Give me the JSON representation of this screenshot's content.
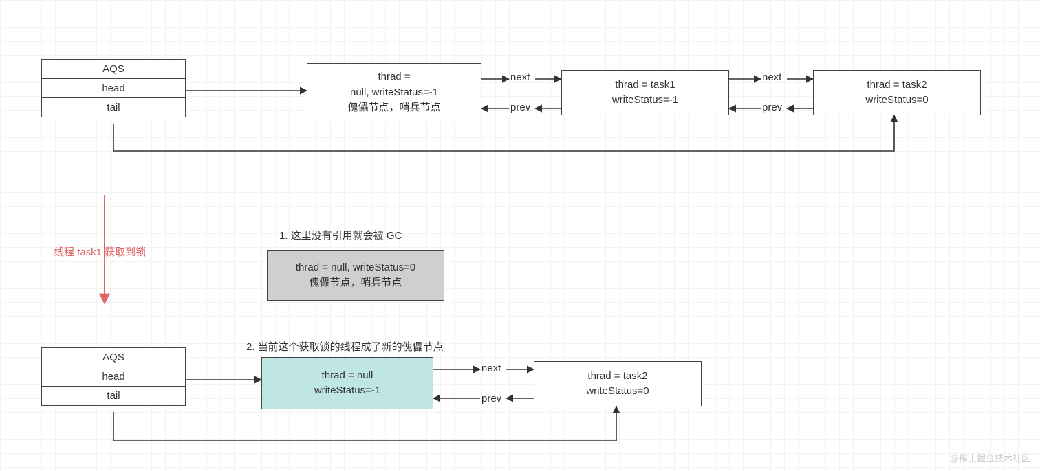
{
  "top": {
    "aqs": {
      "title": "AQS",
      "head": "head",
      "tail": "tail"
    },
    "sentinel": {
      "line1": "thrad =",
      "line2": "null, writeStatus=-1",
      "line3": "傀儡节点，哨兵节点"
    },
    "task1": {
      "line1": "thrad = task1",
      "line2": "writeStatus=-1"
    },
    "task2": {
      "line1": "thrad = task2",
      "line2": "writeStatus=0"
    },
    "linkNext": "next",
    "linkPrev": "prev"
  },
  "transition": {
    "label": "线程 task1 获取到锁"
  },
  "mid": {
    "note1": "1. 这里没有引用就会被 GC",
    "gc": {
      "line1": "thrad = null, writeStatus=0",
      "line2": "傀儡节点，哨兵节点"
    }
  },
  "bottom": {
    "note2": "2. 当前这个获取锁的线程成了新的傀儡节点",
    "aqs": {
      "title": "AQS",
      "head": "head",
      "tail": "tail"
    },
    "newSentinel": {
      "line1": "thrad = null",
      "line2": "writeStatus=-1"
    },
    "task2": {
      "line1": "thrad = task2",
      "line2": "writeStatus=0"
    },
    "linkNext": "next",
    "linkPrev": "prev"
  },
  "watermark": "@稀土掘金技术社区"
}
